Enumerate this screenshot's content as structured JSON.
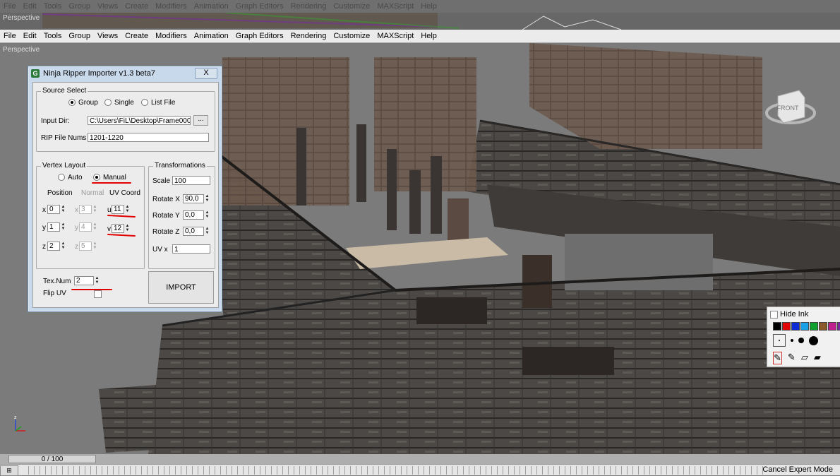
{
  "menu": [
    "File",
    "Edit",
    "Tools",
    "Group",
    "Views",
    "Create",
    "Modifiers",
    "Animation",
    "Graph Editors",
    "Rendering",
    "Customize",
    "MAXScript",
    "Help"
  ],
  "viewport_label_top": "Perspective",
  "viewport_label_main": "Perspective",
  "viewcube_label": "FRONT",
  "axis_label": "z",
  "dialog": {
    "title": "Ninja Ripper Importer v1.3 beta7",
    "close": "X",
    "source_select": {
      "legend": "Source Select",
      "options": [
        "Group",
        "Single",
        "List File"
      ],
      "selected": "Group"
    },
    "input_dir_label": "Input Dir:",
    "input_dir_value": "C:\\Users\\FiL\\Desktop\\Frame000",
    "browse_label": "...",
    "rip_nums_label": "RIP File Nums",
    "rip_nums_value": "1201-1220",
    "vertex_layout": {
      "legend": "Vertex Layout",
      "auto_label": "Auto",
      "manual_label": "Manual",
      "selected": "Manual",
      "position_label": "Position",
      "normal_label": "Normal",
      "uv_label": "UV Coord",
      "pos": {
        "x_label": "x",
        "x": "0",
        "y_label": "y",
        "y": "1",
        "z_label": "z",
        "z": "2"
      },
      "normal": {
        "x_label": "x",
        "x": "3",
        "y_label": "y",
        "y": "4",
        "z_label": "z",
        "z": "5"
      },
      "uv": {
        "u_label": "u",
        "u": "11",
        "v_label": "v",
        "v": "12"
      }
    },
    "transformations": {
      "legend": "Transformations",
      "scale_label": "Scale",
      "scale_value": "100",
      "rotx_label": "Rotate X",
      "rotx_value": "90,0",
      "roty_label": "Rotate Y",
      "roty_value": "0,0",
      "rotz_label": "Rotate Z",
      "rotz_value": "0,0",
      "uv_label": "UV  x",
      "uv_value": "1"
    },
    "tex_num_label": "Tex.Num",
    "tex_num_value": "2",
    "flip_uv_label": "Flip UV",
    "import_label": "IMPORT"
  },
  "ink": {
    "hide_ink_label": "Hide Ink",
    "colors": [
      "#000000",
      "#e00000",
      "#0a2bd6",
      "#1aa0e6",
      "#10a030",
      "#8a5a2a",
      "#c02090",
      "#7a2aa0",
      "#f0e000"
    ]
  },
  "timeline": {
    "frame_label": "0 / 100"
  },
  "status": {
    "cancel_expert_mode": "Cancel Expert Mode"
  }
}
